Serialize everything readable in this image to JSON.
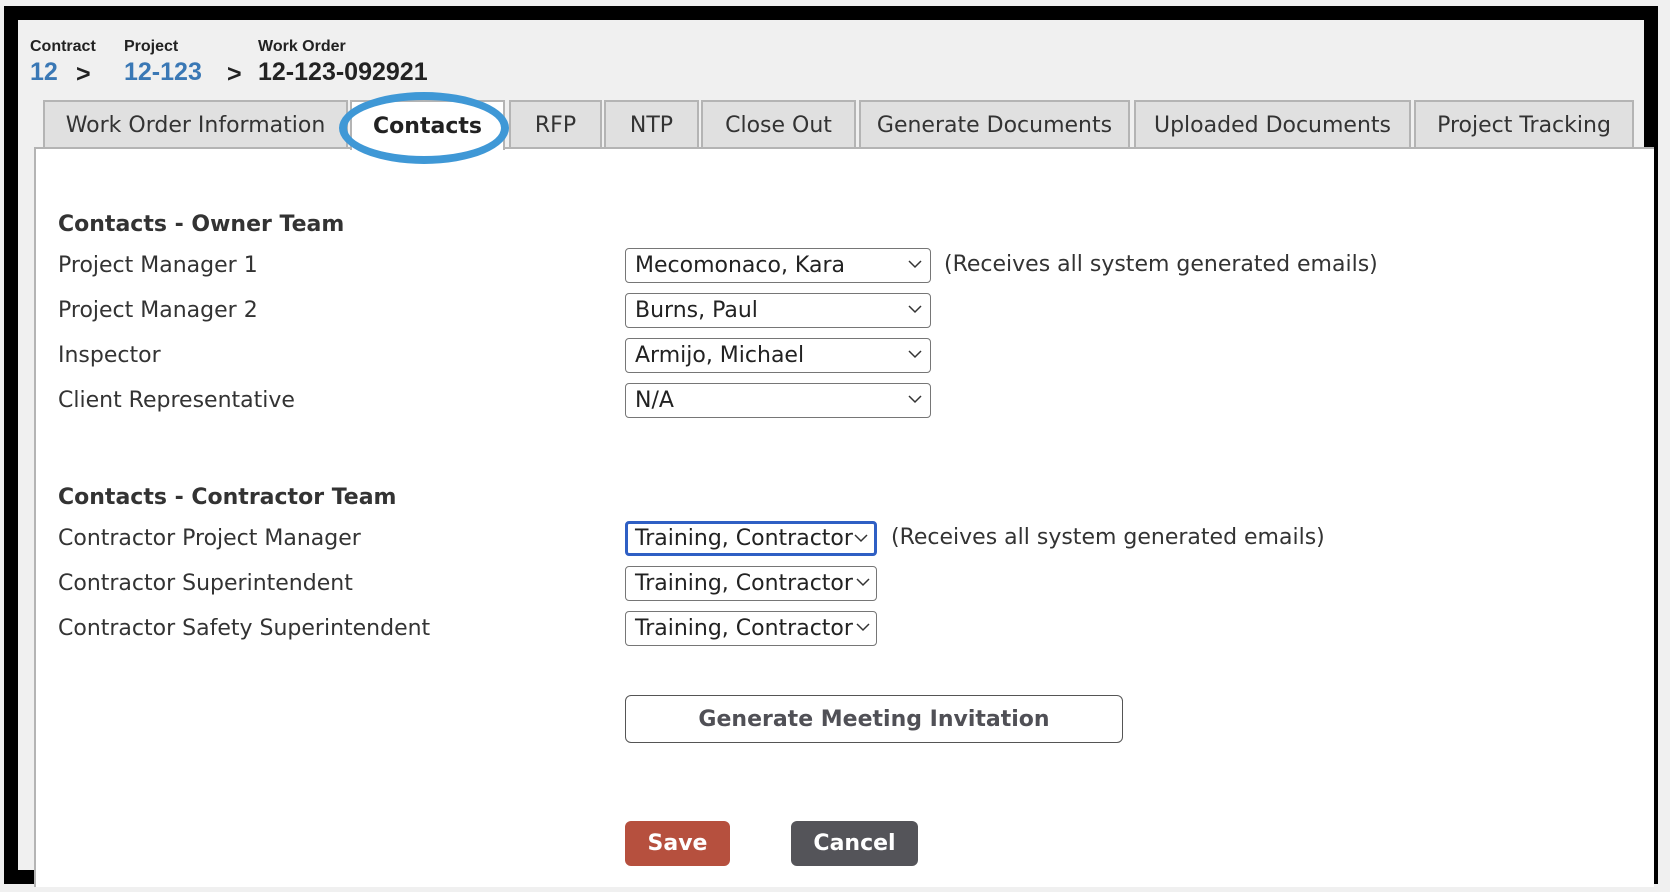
{
  "breadcrumb": {
    "contract": {
      "label": "Contract",
      "value": "12"
    },
    "project": {
      "label": "Project",
      "value": "12-123"
    },
    "work_order": {
      "label": "Work Order",
      "value": "12-123-092921"
    },
    "separator": ">"
  },
  "tabs": [
    {
      "label": "Work Order Information",
      "active": false
    },
    {
      "label": "Contacts",
      "active": true
    },
    {
      "label": "RFP",
      "active": false
    },
    {
      "label": "NTP",
      "active": false
    },
    {
      "label": "Close Out",
      "active": false
    },
    {
      "label": "Generate Documents",
      "active": false
    },
    {
      "label": "Uploaded Documents",
      "active": false
    },
    {
      "label": "Project Tracking",
      "active": false
    }
  ],
  "owner_team": {
    "title": "Contacts - Owner Team",
    "rows": [
      {
        "label": "Project Manager 1",
        "value": "Mecomonaco, Kara",
        "note": "(Receives all system generated emails)"
      },
      {
        "label": "Project Manager 2",
        "value": "Burns, Paul"
      },
      {
        "label": "Inspector",
        "value": "Armijo, Michael"
      },
      {
        "label": "Client Representative",
        "value": "N/A"
      }
    ]
  },
  "contractor_team": {
    "title": "Contacts - Contractor Team",
    "rows": [
      {
        "label": "Contractor Project Manager",
        "value": "Training, Contractor",
        "note": "(Receives all system generated emails)",
        "focused": true
      },
      {
        "label": "Contractor Superintendent",
        "value": "Training, Contractor"
      },
      {
        "label": "Contractor Safety Superintendent",
        "value": "Training, Contractor"
      }
    ]
  },
  "actions": {
    "generate_meeting": "Generate Meeting Invitation",
    "save": "Save",
    "cancel": "Cancel"
  },
  "colors": {
    "link": "#3a78b5",
    "highlight_ring": "#3f98d6",
    "save": "#b6503e",
    "cancel": "#545459",
    "focus": "#2f5fc4"
  }
}
